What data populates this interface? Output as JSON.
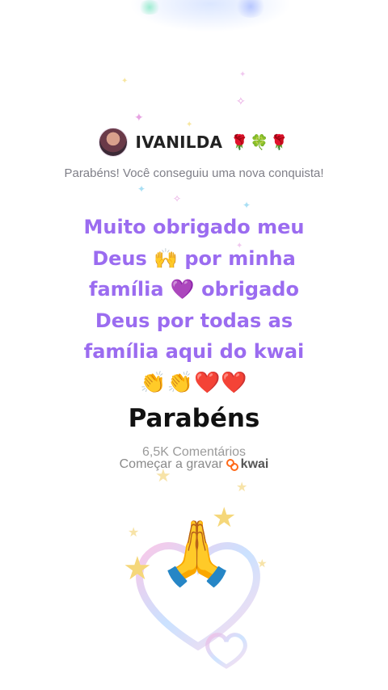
{
  "post": {
    "username": "IVANILDA",
    "username_emojis": "🌹🍀🌹",
    "subtitle": "Parabéns! Você conseguiu uma nova conquista!",
    "message_lines": [
      "Muito obrigado meu",
      "Deus 🙌 por minha",
      "família 💜 obrigado",
      "Deus por todas as",
      "família aqui do kwai"
    ],
    "emoji_row": "👏👏❤️❤️",
    "heading": "Parabéns",
    "comments": "6,5K Comentários",
    "record_label": "Começar a gravar",
    "brand": "kwai",
    "big_emoji": "🙏"
  },
  "colors": {
    "message": "#9b6cf0",
    "brand_orange": "#ff6a1a"
  },
  "icons": [
    "sparkle-icon",
    "star-icon",
    "heart-icon",
    "kwai-logo-icon"
  ]
}
